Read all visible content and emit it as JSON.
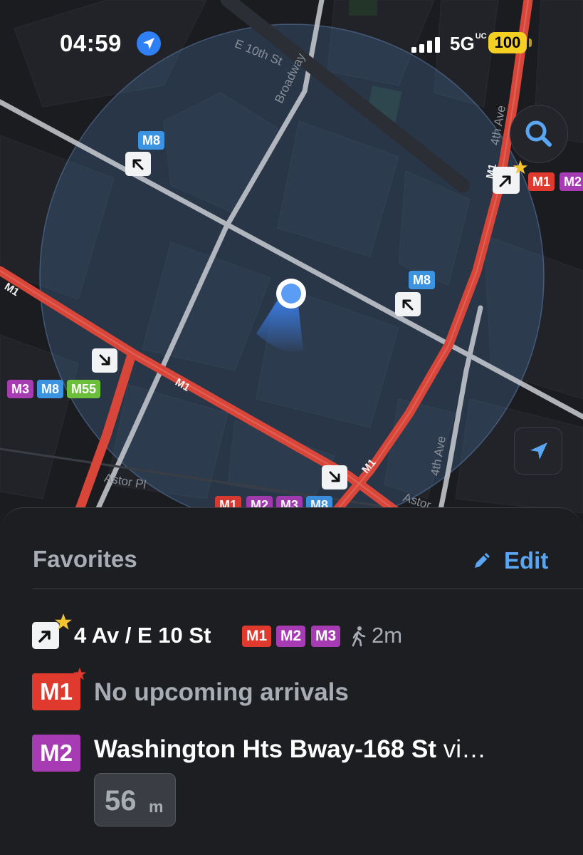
{
  "status_bar": {
    "time": "04:59",
    "network": "5G",
    "network_superscript": "UC",
    "battery": "100"
  },
  "map": {
    "streets": {
      "e10th": "E 10th St",
      "broadway": "Broadway",
      "fourth_ave_top": "4th Ave",
      "fourth_ave_bottom": "4th Ave",
      "astor_pl": "Astor Pl",
      "astor_partial": "Astor"
    },
    "route_line_labels": {
      "m1_left": "M1",
      "m1_mid": "M1",
      "m1_diag": "M1",
      "m1_top": "M1"
    },
    "stop_tags": {
      "upper_left": [
        "M8"
      ],
      "middle_right": [
        "M8"
      ],
      "top_right": [
        "M1",
        "M2"
      ],
      "left_cluster": [
        "M3",
        "M8",
        "M55"
      ],
      "bottom": [
        "M1",
        "M2",
        "M3",
        "M8"
      ]
    },
    "colors": {
      "m1": "#e03a2f",
      "m2": "#a63bb3",
      "m8": "#3b93e2",
      "m55": "#6bbf3a",
      "accent": "#5aa6f2",
      "user_location": "#5b9cf5"
    },
    "icons": [
      "search-icon",
      "location-arrow-icon",
      "bus-stop-arrow-icon",
      "star-icon"
    ]
  },
  "favorites": {
    "title": "Favorites",
    "edit_label": "Edit",
    "stop": {
      "name": "4 Av / E 10 St",
      "routes": [
        "M1",
        "M2",
        "M3"
      ],
      "walk_time": "2m"
    },
    "routes": [
      {
        "badge": "M1",
        "message": "No upcoming arrivals"
      },
      {
        "badge": "M2",
        "destination": "Washington Hts Bway-168 St",
        "via": " vi…",
        "eta_value": "56",
        "eta_unit": "m"
      }
    ]
  }
}
